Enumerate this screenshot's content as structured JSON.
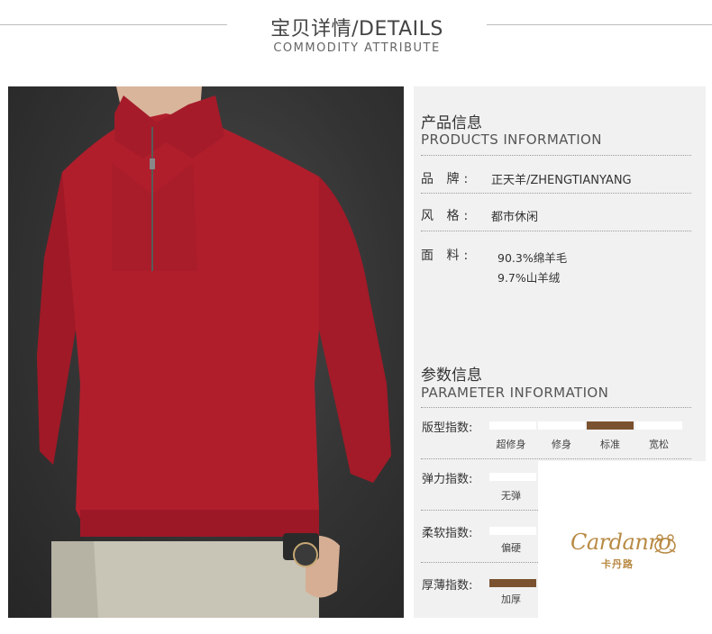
{
  "header": {
    "title": "宝贝详情/DETAILS",
    "subtitle": "COMMODITY ATTRIBUTE"
  },
  "products": {
    "title": "产品信息",
    "subtitle": "PRODUCTS INFORMATION",
    "rows": [
      {
        "label": "品 牌:",
        "values": [
          "正天羊/ZHENGTIANYANG"
        ]
      },
      {
        "label": "风 格:",
        "values": [
          "都市休闲"
        ]
      },
      {
        "label": "面 料:",
        "values": [
          "90.3%绵羊毛",
          "9.7%山羊绒"
        ]
      }
    ]
  },
  "parameters": {
    "title": "参数信息",
    "subtitle": "PARAMETER INFORMATION",
    "items": [
      {
        "label": "版型指数:",
        "options": [
          "超修身",
          "修身",
          "标准",
          "宽松"
        ],
        "selected": 2
      },
      {
        "label": "弹力指数:",
        "options": [
          "无弹"
        ],
        "selected": null
      },
      {
        "label": "柔软指数:",
        "options": [
          "偏硬"
        ],
        "selected": null
      },
      {
        "label": "厚薄指数:",
        "options": [
          "加厚"
        ],
        "selected": 0
      }
    ]
  },
  "logo": {
    "script": "Cardanro",
    "chinese": "卡丹路"
  },
  "colors": {
    "sweater": "#b01e2c",
    "accent_bar": "#7a5230",
    "logo_gold": "#b88a44",
    "panel_bg": "#f1f1f1"
  }
}
